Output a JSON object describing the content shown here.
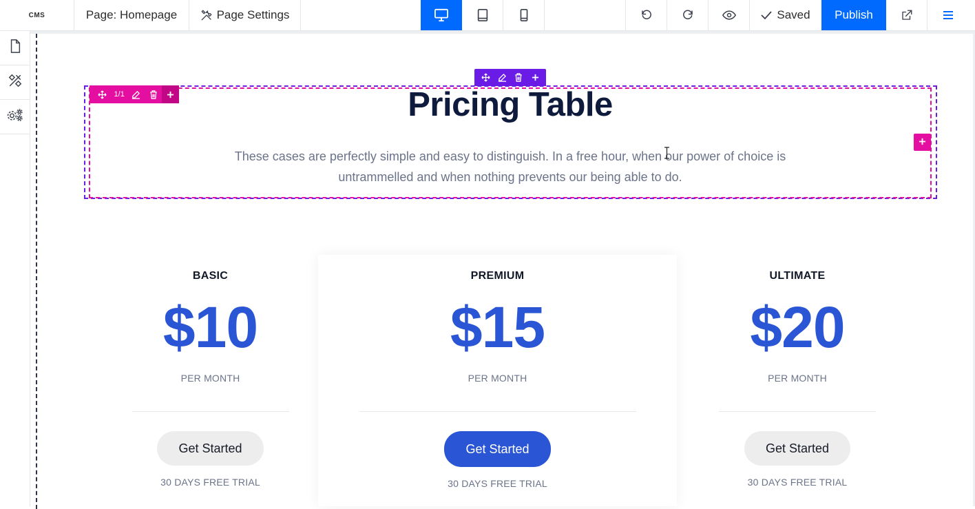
{
  "app": {
    "logo": "CMS"
  },
  "topbar": {
    "page_label": "Page: Homepage",
    "settings_label": "Page Settings",
    "saved_label": "Saved",
    "publish_label": "Publish",
    "active_device": "desktop"
  },
  "colors": {
    "accent": "#006aff",
    "price": "#2a55d4",
    "selection_outer": "#6a1be6",
    "selection_inner": "#e40fa0"
  },
  "editor": {
    "row_toolbar": {
      "position": "1/1"
    }
  },
  "section": {
    "title": "Pricing Table",
    "subtitle_line1": "These cases are perfectly simple and easy to distinguish. In a free hour, when our power of choice is",
    "subtitle_line2": "untrammelled and when nothing prevents our being able to do."
  },
  "plans": [
    {
      "name": "BASIC",
      "price": "$10",
      "period": "PER MONTH",
      "cta": "Get Started",
      "trial": "30 DAYS FREE TRIAL",
      "highlighted": false
    },
    {
      "name": "PREMIUM",
      "price": "$15",
      "period": "PER MONTH",
      "cta": "Get Started",
      "trial": "30 DAYS FREE TRIAL",
      "highlighted": true
    },
    {
      "name": "ULTIMATE",
      "price": "$20",
      "period": "PER MONTH",
      "cta": "Get Started",
      "trial": "30 DAYS FREE TRIAL",
      "highlighted": false
    }
  ]
}
